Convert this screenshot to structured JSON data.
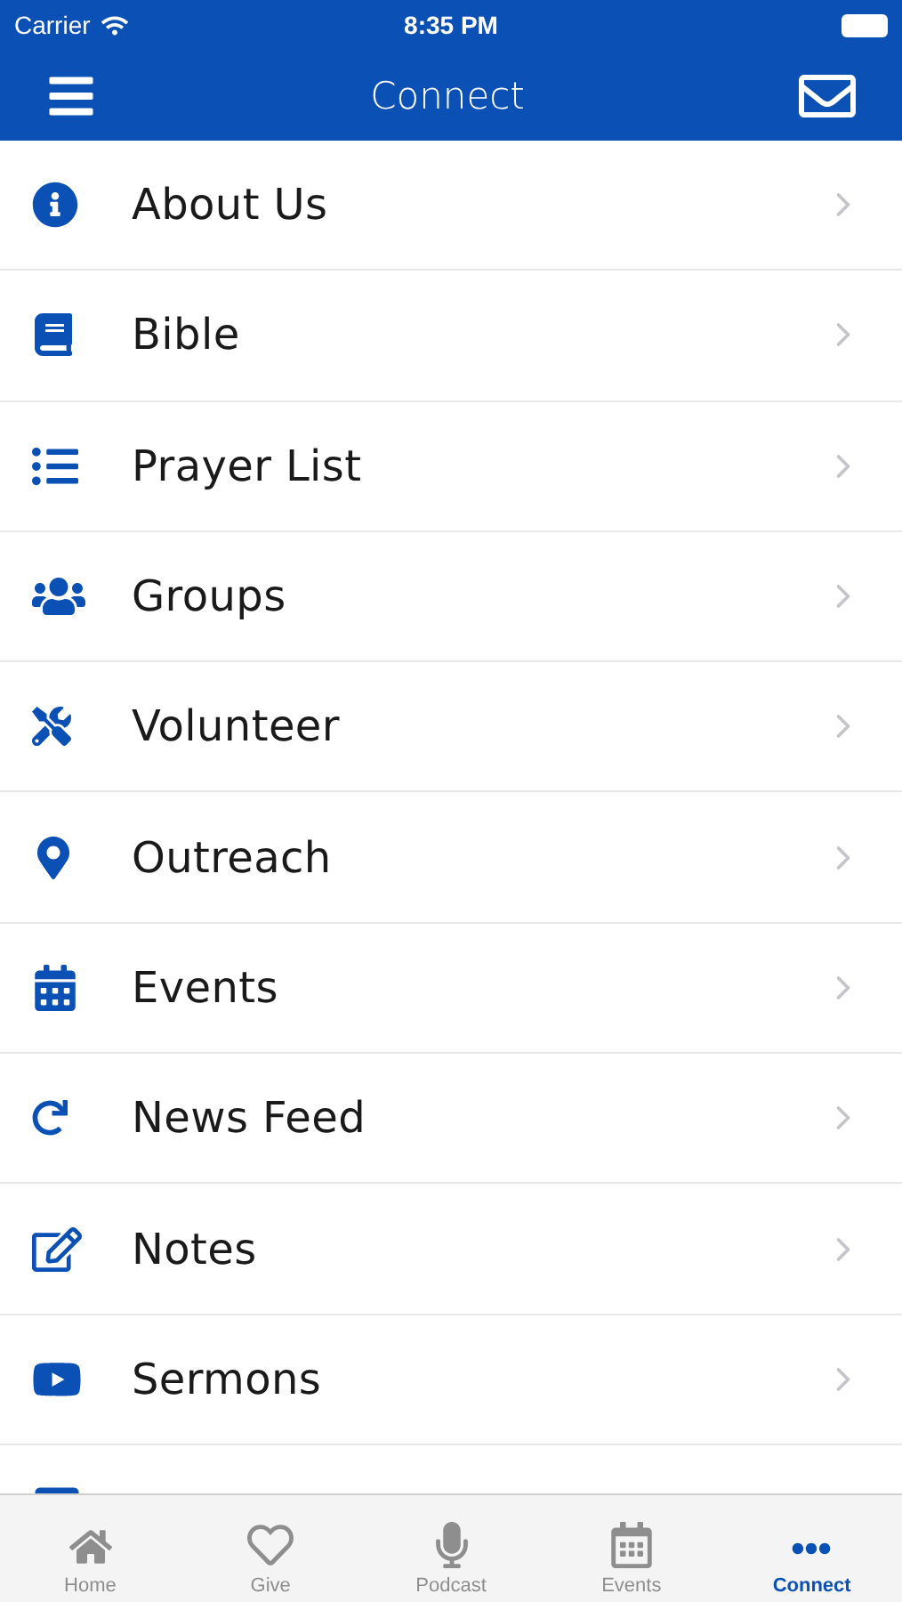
{
  "status_bar": {
    "carrier": "Carrier",
    "time": "8:35 PM"
  },
  "nav_bar": {
    "title": "Connect"
  },
  "menu": [
    {
      "kind": "info",
      "label": "About Us"
    },
    {
      "kind": "book",
      "label": "Bible"
    },
    {
      "kind": "list",
      "label": "Prayer List"
    },
    {
      "kind": "users",
      "label": "Groups"
    },
    {
      "kind": "tools",
      "label": "Volunteer"
    },
    {
      "kind": "pin",
      "label": "Outreach"
    },
    {
      "kind": "calendar",
      "label": "Events"
    },
    {
      "kind": "refresh",
      "label": "News Feed"
    },
    {
      "kind": "edit",
      "label": "Notes"
    },
    {
      "kind": "video",
      "label": "Sermons"
    },
    {
      "kind": "square"
    }
  ],
  "tab_bar": [
    {
      "kind": "home",
      "label": "Home",
      "selected": false
    },
    {
      "kind": "heart",
      "label": "Give",
      "selected": false
    },
    {
      "kind": "mic",
      "label": "Podcast",
      "selected": false
    },
    {
      "kind": "calendar",
      "label": "Events",
      "selected": false
    },
    {
      "kind": "more",
      "label": "Connect",
      "selected": true
    }
  ]
}
